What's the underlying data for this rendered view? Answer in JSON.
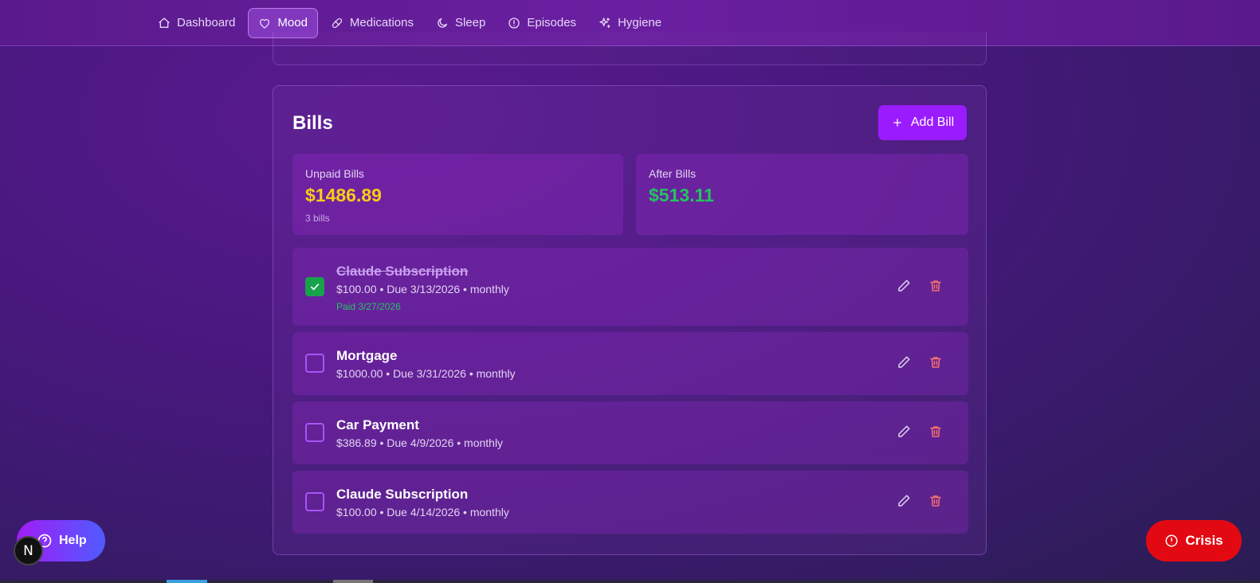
{
  "nav": {
    "items": [
      {
        "label": "Dashboard",
        "icon": "home-icon",
        "active": false
      },
      {
        "label": "Mood",
        "icon": "heart-icon",
        "active": true
      },
      {
        "label": "Medications",
        "icon": "pill-icon",
        "active": false
      },
      {
        "label": "Sleep",
        "icon": "moon-icon",
        "active": false
      },
      {
        "label": "Episodes",
        "icon": "alert-circle-icon",
        "active": false
      },
      {
        "label": "Hygiene",
        "icon": "sparkles-icon",
        "active": false
      }
    ]
  },
  "bills": {
    "title": "Bills",
    "add_label": "Add Bill",
    "unpaid": {
      "label": "Unpaid Bills",
      "value": "$1486.89",
      "sub": "3 bills",
      "color": "#facc15"
    },
    "after": {
      "label": "After Bills",
      "value": "$513.11",
      "color": "#22c55e"
    },
    "items": [
      {
        "name": "Claude Subscription",
        "meta": "$100.00 • Due 3/13/2026 • monthly",
        "paid": true,
        "paid_note": "Paid 3/27/2026"
      },
      {
        "name": "Mortgage",
        "meta": "$1000.00 • Due 3/31/2026 • monthly",
        "paid": false
      },
      {
        "name": "Car Payment",
        "meta": "$386.89 • Due 4/9/2026 • monthly",
        "paid": false
      },
      {
        "name": "Claude Subscription",
        "meta": "$100.00 • Due 4/14/2026 • monthly",
        "paid": false
      }
    ]
  },
  "help": {
    "label": "Help"
  },
  "crisis": {
    "label": "Crisis"
  },
  "badge": {
    "letter": "N"
  }
}
